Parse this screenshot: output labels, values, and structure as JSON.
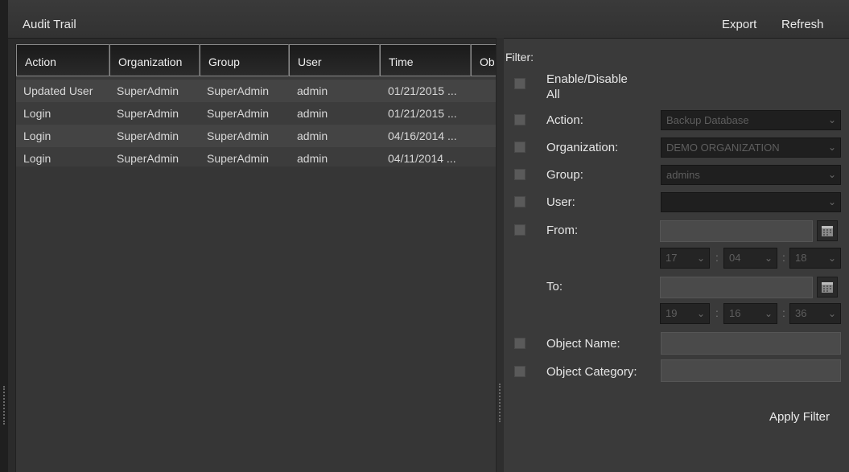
{
  "header": {
    "title": "Audit Trail",
    "export_label": "Export",
    "refresh_label": "Refresh"
  },
  "table": {
    "columns": [
      "Action",
      "Organization",
      "Group",
      "User",
      "Time",
      "Ob"
    ],
    "rows": [
      [
        "Updated User",
        "SuperAdmin",
        "SuperAdmin",
        "admin",
        "01/21/2015 ..."
      ],
      [
        "Login",
        "SuperAdmin",
        "SuperAdmin",
        "admin",
        "01/21/2015 ..."
      ],
      [
        "Login",
        "SuperAdmin",
        "SuperAdmin",
        "admin",
        "04/16/2014 ..."
      ],
      [
        "Login",
        "SuperAdmin",
        "SuperAdmin",
        "admin",
        "04/11/2014 ..."
      ]
    ]
  },
  "filter": {
    "heading": "Filter:",
    "enable_all_label_1": "Enable/Disable",
    "enable_all_label_2": "All",
    "action_label": "Action:",
    "action_value": "Backup Database",
    "organization_label": "Organization:",
    "organization_value": "DEMO ORGANIZATION",
    "group_label": "Group:",
    "group_value": "admins",
    "user_label": "User:",
    "user_value": "",
    "from_label": "From:",
    "from_date": "",
    "from_hour": "17",
    "from_minute": "04",
    "from_second": "18",
    "to_label": "To:",
    "to_date": "",
    "to_hour": "19",
    "to_minute": "16",
    "to_second": "36",
    "object_name_label": "Object Name:",
    "object_category_label": "Object Category:",
    "apply_label": "Apply Filter"
  },
  "icons": {
    "calendar": "calendar-icon",
    "chevron": "chevron-down-icon"
  }
}
